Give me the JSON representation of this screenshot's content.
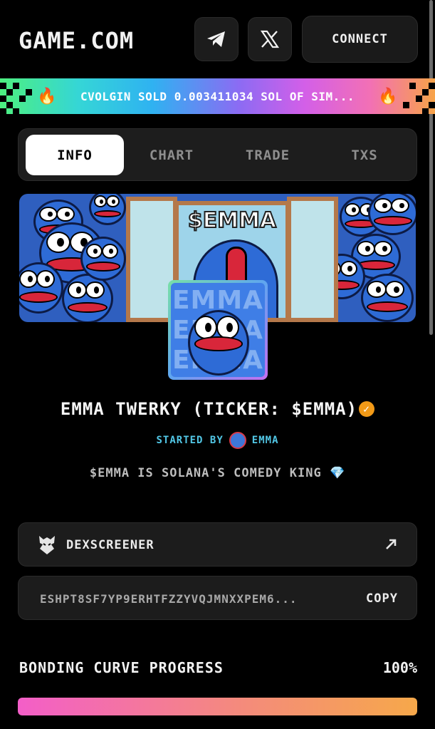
{
  "header": {
    "logo": "GAME.COM",
    "telegram_icon": "telegram-icon",
    "x_icon": "x-icon",
    "connect_label": "CONNECT"
  },
  "ticker": {
    "message": "CVOLGIN SOLD 0.003411034 SOL OF SIM...",
    "icon": "fire-icon"
  },
  "tabs": [
    {
      "label": "INFO",
      "active": true
    },
    {
      "label": "CHART",
      "active": false
    },
    {
      "label": "TRADE",
      "active": false
    },
    {
      "label": "TXS",
      "active": false
    }
  ],
  "banner": {
    "title": "$EMMA",
    "avatar_text": "EMMA"
  },
  "token": {
    "title": "EMMA TWERKY (TICKER: $EMMA)",
    "verified_icon": "verified-badge-icon",
    "started_by_label": "STARTED BY",
    "creator": "EMMA",
    "description": "$EMMA IS SOLANA'S COMEDY KING",
    "description_icon": "gem-icon"
  },
  "links": {
    "dexscreener_label": "DEXSCREENER",
    "address": "ESHPT8SF7YP9ERHTFZZYVQJMNXXPEM6...",
    "copy_label": "COPY"
  },
  "progress": {
    "label": "BONDING CURVE PROGRESS",
    "value_text": "100%",
    "value": 1.0
  },
  "colors": {
    "accent_blue": "#52c7e6",
    "verified_orange": "#f29a17",
    "progress_start": "#f35ec8",
    "progress_end": "#f6a84a"
  }
}
